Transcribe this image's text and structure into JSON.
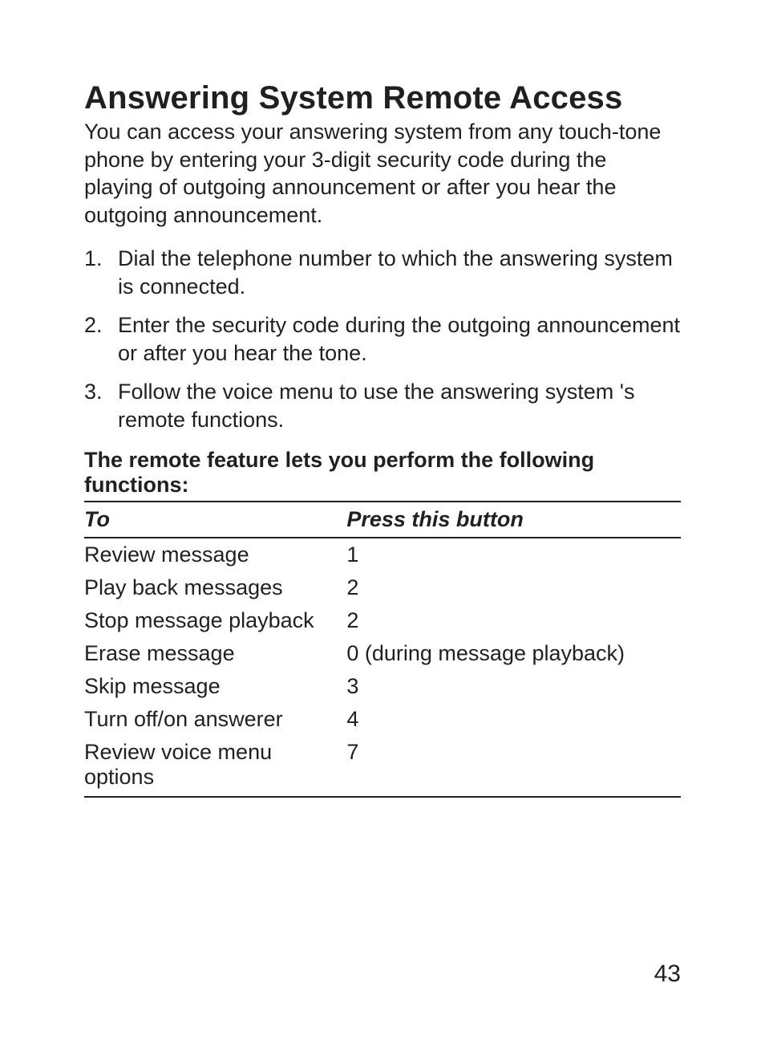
{
  "heading": "Answering System Remote Access",
  "intro": "You can access your answering system from any touch-tone phone by entering your 3-digit security code during the playing of outgoing announcement or after you hear the outgoing announcement.",
  "steps": [
    "Dial the telephone number to which the answering system is connected.",
    "Enter the security code during the outgoing announcement or after you hear the tone.",
    "Follow the voice menu to use the answering system 's remote functions."
  ],
  "subhead": "The remote feature lets you perform the following functions:",
  "table": {
    "headers": {
      "to": "To",
      "press": "Press this button"
    },
    "rows": [
      {
        "to": "Review message",
        "press": "1"
      },
      {
        "to": "Play back messages",
        "press": "2"
      },
      {
        "to": "Stop message playback",
        "press": "2"
      },
      {
        "to": "Erase message",
        "press": "0 (during message playback)"
      },
      {
        "to": "Skip message",
        "press": "3"
      },
      {
        "to": "Turn off/on answerer",
        "press": "4"
      },
      {
        "to": "Review voice menu options",
        "press": "7"
      }
    ]
  },
  "page_number": "43"
}
